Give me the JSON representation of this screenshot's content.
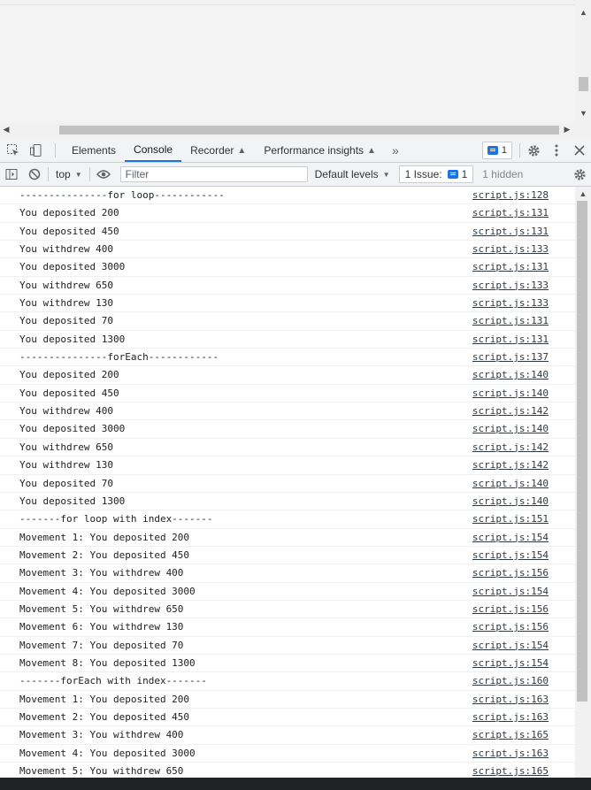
{
  "tabs": {
    "items": [
      {
        "label": "Elements"
      },
      {
        "label": "Console"
      },
      {
        "label": "Recorder"
      },
      {
        "label": "Performance insights"
      }
    ],
    "more": "»",
    "issues_badge": "1"
  },
  "toolbar": {
    "context": "top",
    "filter_placeholder": "Filter",
    "levels": "Default levels",
    "issues_label": "1 Issue:",
    "issues_count": "1",
    "hidden": "1 hidden"
  },
  "console": {
    "rows": [
      {
        "msg": "---------------for loop------------",
        "src": "script.js:128"
      },
      {
        "msg": "You deposited 200",
        "src": "script.js:131"
      },
      {
        "msg": "You deposited 450",
        "src": "script.js:131"
      },
      {
        "msg": "You withdrew 400",
        "src": "script.js:133"
      },
      {
        "msg": "You deposited 3000",
        "src": "script.js:131"
      },
      {
        "msg": "You withdrew 650",
        "src": "script.js:133"
      },
      {
        "msg": "You withdrew 130",
        "src": "script.js:133"
      },
      {
        "msg": "You deposited 70",
        "src": "script.js:131"
      },
      {
        "msg": "You deposited 1300",
        "src": "script.js:131"
      },
      {
        "msg": "---------------forEach------------",
        "src": "script.js:137"
      },
      {
        "msg": "You deposited 200",
        "src": "script.js:140"
      },
      {
        "msg": "You deposited 450",
        "src": "script.js:140"
      },
      {
        "msg": "You withdrew 400",
        "src": "script.js:142"
      },
      {
        "msg": "You deposited 3000",
        "src": "script.js:140"
      },
      {
        "msg": "You withdrew 650",
        "src": "script.js:142"
      },
      {
        "msg": "You withdrew 130",
        "src": "script.js:142"
      },
      {
        "msg": "You deposited 70",
        "src": "script.js:140"
      },
      {
        "msg": "You deposited 1300",
        "src": "script.js:140"
      },
      {
        "msg": "-------for loop with index-------",
        "src": "script.js:151"
      },
      {
        "msg": "Movement 1: You deposited 200",
        "src": "script.js:154"
      },
      {
        "msg": "Movement 2: You deposited 450",
        "src": "script.js:154"
      },
      {
        "msg": "Movement 3: You withdrew 400",
        "src": "script.js:156"
      },
      {
        "msg": "Movement 4: You deposited 3000",
        "src": "script.js:154"
      },
      {
        "msg": "Movement 5: You withdrew 650",
        "src": "script.js:156"
      },
      {
        "msg": "Movement 6: You withdrew 130",
        "src": "script.js:156"
      },
      {
        "msg": "Movement 7: You deposited 70",
        "src": "script.js:154"
      },
      {
        "msg": "Movement 8: You deposited 1300",
        "src": "script.js:154"
      },
      {
        "msg": "-------forEach with index-------",
        "src": "script.js:160"
      },
      {
        "msg": "Movement 1: You deposited 200",
        "src": "script.js:163"
      },
      {
        "msg": "Movement 2: You deposited 450",
        "src": "script.js:163"
      },
      {
        "msg": "Movement 3: You withdrew 400",
        "src": "script.js:165"
      },
      {
        "msg": "Movement 4: You deposited 3000",
        "src": "script.js:163"
      },
      {
        "msg": "Movement 5: You withdrew 650",
        "src": "script.js:165"
      }
    ]
  }
}
